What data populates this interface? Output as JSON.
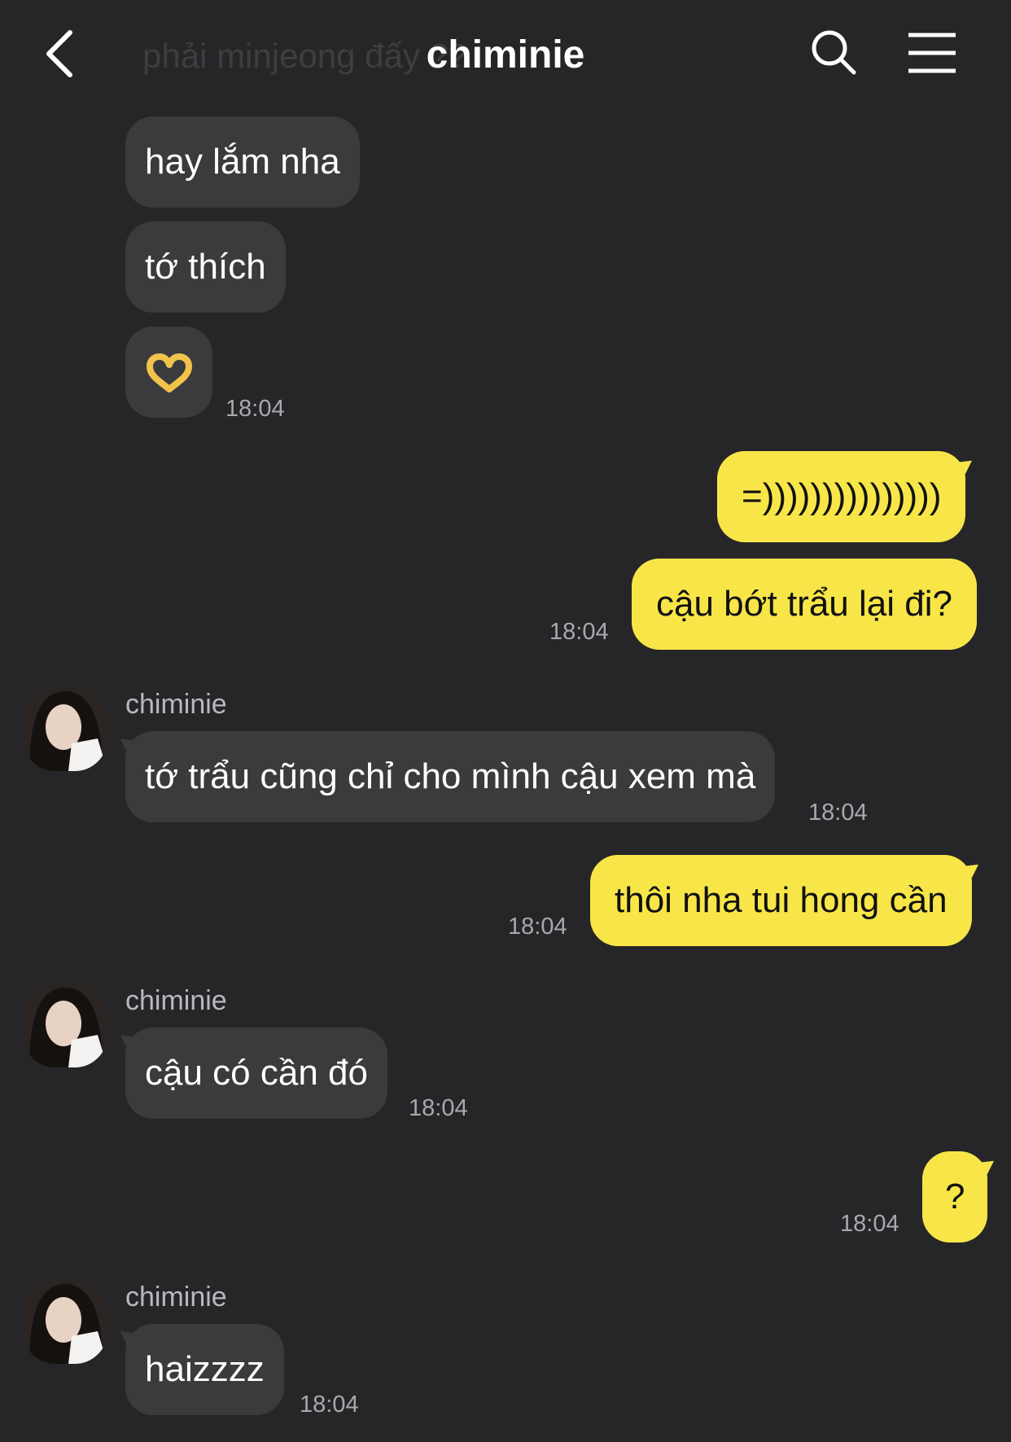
{
  "header": {
    "ghost_text": "phải minjeong đấy ??",
    "title": "chiminie"
  },
  "messages": [
    {
      "dir": "in",
      "text": "hay lắm nha"
    },
    {
      "dir": "in",
      "text": "tớ thích"
    },
    {
      "dir": "in",
      "text": "🫶",
      "time": "18:04"
    },
    {
      "dir": "out",
      "text": "=)))))))))))))))"
    },
    {
      "dir": "out",
      "text": "cậu bớt trẩu lại đi?",
      "time": "18:04"
    },
    {
      "dir": "in",
      "sender": "chiminie",
      "text": "tớ trẩu cũng chỉ cho mình cậu xem mà",
      "time": "18:04"
    },
    {
      "dir": "out",
      "text": "thôi nha tui hong cần",
      "time": "18:04"
    },
    {
      "dir": "in",
      "sender": "chiminie",
      "text": "cậu có cần đó",
      "time": "18:04"
    },
    {
      "dir": "out",
      "text": "?",
      "time": "18:04"
    },
    {
      "dir": "in",
      "sender": "chiminie",
      "text": "haizzzz",
      "time": "18:04"
    }
  ],
  "icons": {
    "back": "chevron-left-icon",
    "search": "search-icon",
    "menu": "hamburger-menu-icon",
    "avatar": "profile-photo"
  },
  "colors": {
    "background": "#262628",
    "incoming_bubble": "#3b3b3e",
    "outgoing_bubble": "#f8e648",
    "timestamp": "#a9a9ad"
  }
}
